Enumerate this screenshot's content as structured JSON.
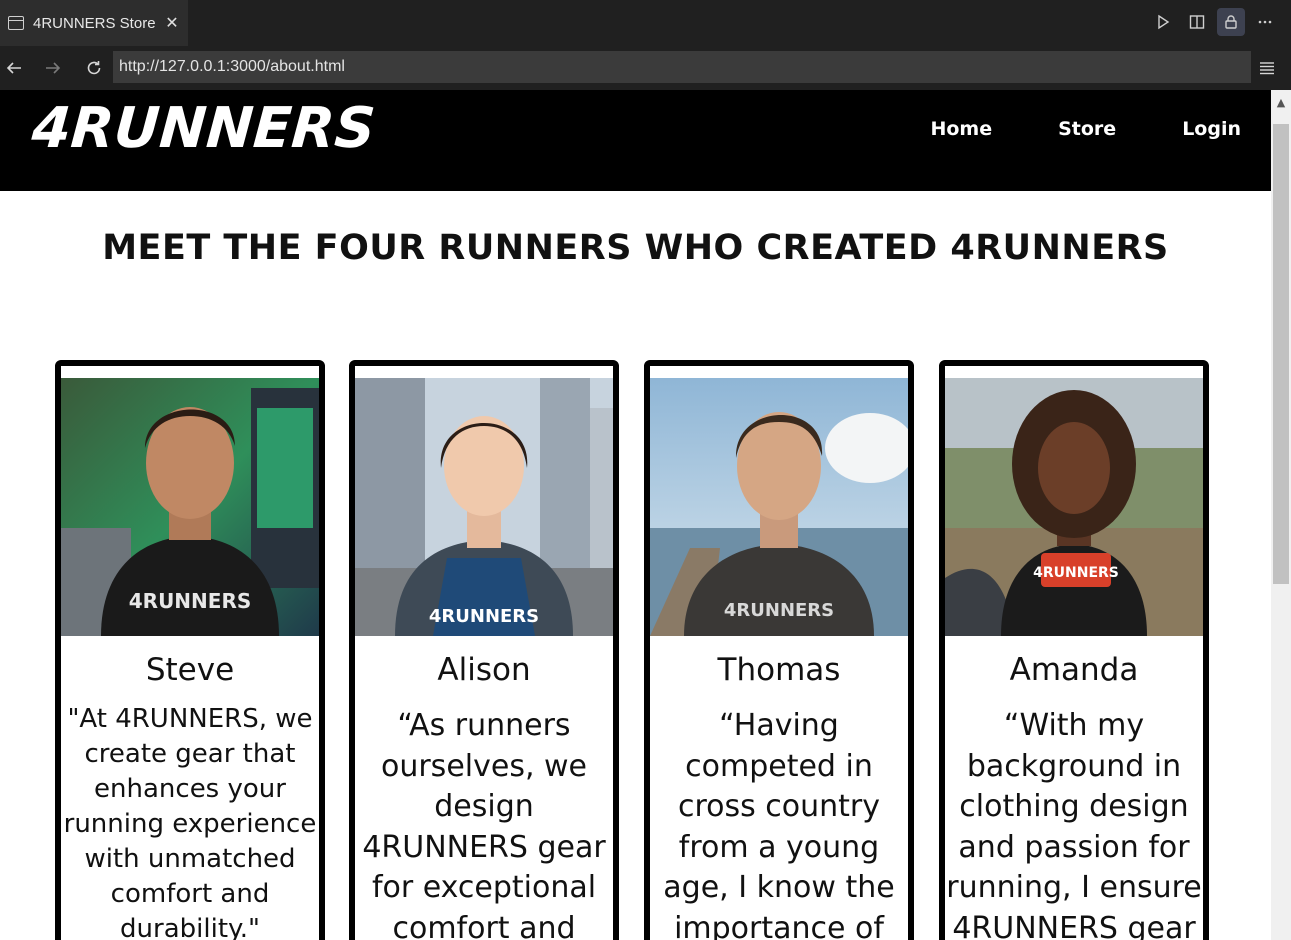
{
  "browser": {
    "tab_title": "4RUNNERS Store",
    "tab_close": "✕",
    "url": "http://127.0.0.1:3000/about.html",
    "icons": [
      "window-icon",
      "close-icon",
      "play-icon",
      "split-view-icon",
      "lock-icon",
      "more-icon",
      "back-icon",
      "forward-icon",
      "reload-icon",
      "menu-icon"
    ]
  },
  "site": {
    "logo": "4RUNNERS",
    "nav": {
      "home": "Home",
      "store": "Store",
      "login": "Login"
    },
    "heading": "MEET THE FOUR RUNNERS WHO CREATED 4RUNNERS"
  },
  "runners": [
    {
      "name": "Steve",
      "quote": "\"At 4RUNNERS, we create gear that enhances your running experience with unmatched comfort and durability.\"",
      "shirt_text": "4RUNNERS"
    },
    {
      "name": "Alison",
      "quote": "“As runners ourselves, we design 4RUNNERS gear for exceptional comfort and",
      "shirt_text": "4RUNNERS"
    },
    {
      "name": "Thomas",
      "quote": "“Having competed in cross country from a young age, I know the importance of",
      "shirt_text": "4RUNNERS"
    },
    {
      "name": "Amanda",
      "quote": "“With my background in clothing design and passion for running, I ensure 4RUNNERS gear",
      "shirt_text": "4RUNNERS"
    }
  ]
}
